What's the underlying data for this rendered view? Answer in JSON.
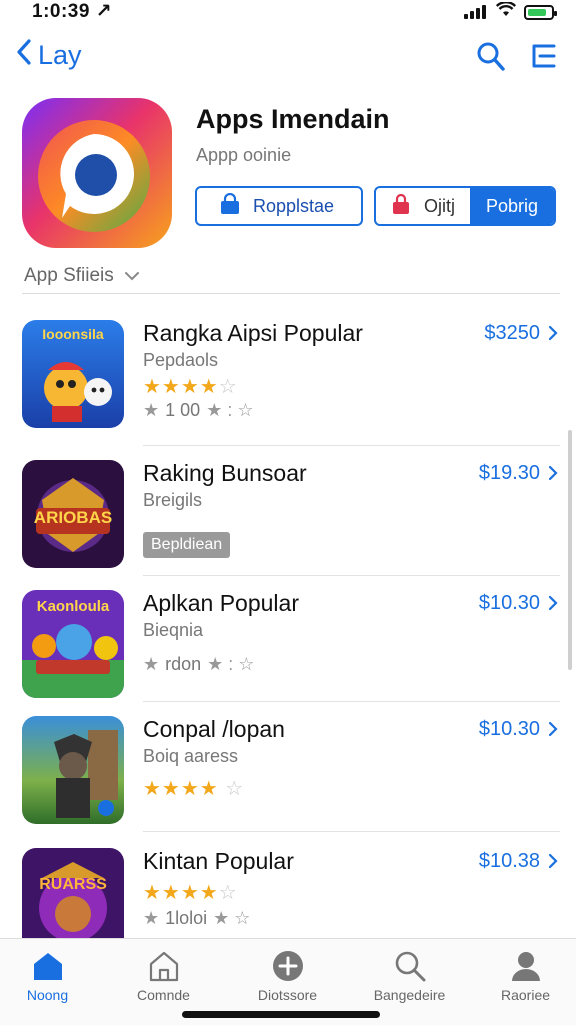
{
  "status": {
    "time": "1:0:39 ↗"
  },
  "nav": {
    "back_label": "Lay"
  },
  "app": {
    "title": "Apps Imendain",
    "subtitle": "Appp ooinie",
    "button1": "Ropplstae",
    "button2_left": "Ojitj",
    "button2_right": "Pobrig"
  },
  "section": {
    "label": "App Sfiieis"
  },
  "rows": [
    {
      "name": "Rangka Aipsi Popular",
      "sub": "Pepdaols",
      "price": "$3250",
      "stars": "★★★★",
      "stars_empty": "☆",
      "meta": "1 00",
      "thumb_text": "Iooonsila"
    },
    {
      "name": "Raking Bunsoar",
      "sub": "Breigils",
      "price": "$19.30",
      "tag": "Bepldiean",
      "thumb_text": "ARIOBAS"
    },
    {
      "name": "Aplkan Popular",
      "sub": "Bieqnia",
      "price": "$10.30",
      "meta": "rdon",
      "thumb_text": "Kaonloula"
    },
    {
      "name": "Conpal /lopan",
      "sub": "Boiq aaress",
      "price": "$10.30",
      "stars": "★★★★",
      "stars_empty": "☆"
    },
    {
      "name": "Kintan Popular",
      "price": "$10.38",
      "stars": "★★★★",
      "stars_empty": "☆",
      "meta": "1loloi",
      "thumb_text": "RUARSS"
    }
  ],
  "tabs": [
    {
      "label": "Noong"
    },
    {
      "label": "Comnde"
    },
    {
      "label": "Diotssore"
    },
    {
      "label": "Bangedeire"
    },
    {
      "label": "Raoriee"
    }
  ],
  "colors": {
    "accent": "#1a6fe0",
    "star": "#f3a81c"
  }
}
